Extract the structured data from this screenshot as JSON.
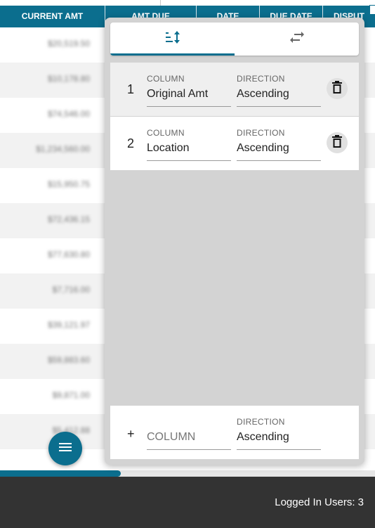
{
  "table": {
    "headers": [
      "CURRENT AMT",
      "AMT DUE",
      "DATE",
      "DUE DATE",
      "DISPUT"
    ],
    "rows": [
      "$20,519.50",
      "$10,178.80",
      "$74,546.00",
      "$1,234,560.00",
      "$15,950.75",
      "$72,436.15",
      "$77,630.80",
      "$7,716.00",
      "$39,121.97",
      "$59,883.60",
      "$9,871.00",
      "$5,412.88"
    ]
  },
  "sort_panel": {
    "tabs": [
      {
        "name": "sort",
        "icon": "sort-icon"
      },
      {
        "name": "swap",
        "icon": "swap-icon"
      }
    ],
    "column_label": "COLUMN",
    "direction_label": "DIRECTION",
    "rows": [
      {
        "index": "1",
        "column": "Original Amt",
        "direction": "Ascending"
      },
      {
        "index": "2",
        "column": "Location",
        "direction": "Ascending"
      }
    ],
    "add_row": {
      "symbol": "+",
      "column_placeholder": "COLUMN",
      "direction": "Ascending"
    }
  },
  "footer": {
    "logged_in": "Logged In Users: 3"
  },
  "colors": {
    "accent": "#0b6e8e",
    "panel_bg": "#d3d3d3",
    "footer_bg": "#333333"
  }
}
